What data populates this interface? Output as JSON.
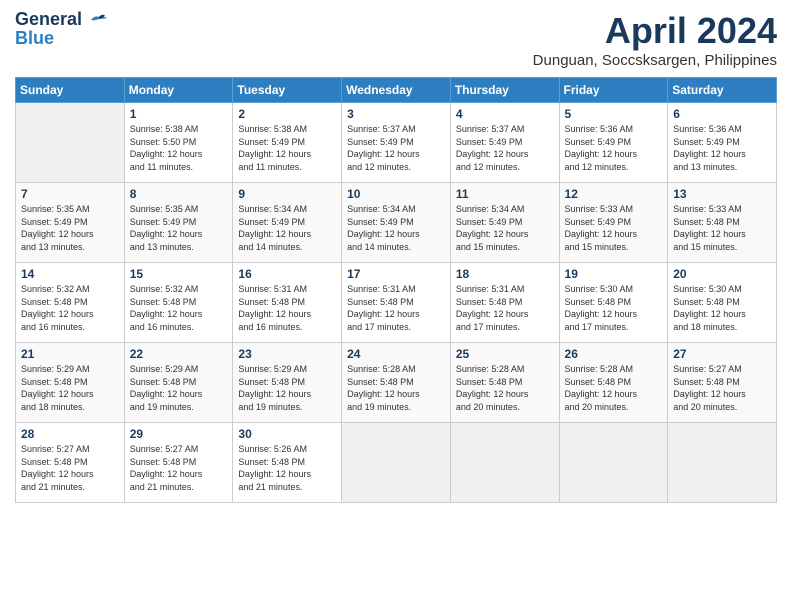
{
  "header": {
    "logo_general": "General",
    "logo_blue": "Blue",
    "month_title": "April 2024",
    "location": "Dunguan, Soccsksargen, Philippines"
  },
  "weekdays": [
    "Sunday",
    "Monday",
    "Tuesday",
    "Wednesday",
    "Thursday",
    "Friday",
    "Saturday"
  ],
  "weeks": [
    [
      {
        "day": "",
        "empty": true
      },
      {
        "day": "1",
        "sunrise": "5:38 AM",
        "sunset": "5:50 PM",
        "daylight": "12 hours and 11 minutes."
      },
      {
        "day": "2",
        "sunrise": "5:38 AM",
        "sunset": "5:49 PM",
        "daylight": "12 hours and 11 minutes."
      },
      {
        "day": "3",
        "sunrise": "5:37 AM",
        "sunset": "5:49 PM",
        "daylight": "12 hours and 12 minutes."
      },
      {
        "day": "4",
        "sunrise": "5:37 AM",
        "sunset": "5:49 PM",
        "daylight": "12 hours and 12 minutes."
      },
      {
        "day": "5",
        "sunrise": "5:36 AM",
        "sunset": "5:49 PM",
        "daylight": "12 hours and 12 minutes."
      },
      {
        "day": "6",
        "sunrise": "5:36 AM",
        "sunset": "5:49 PM",
        "daylight": "12 hours and 13 minutes."
      }
    ],
    [
      {
        "day": "7",
        "sunrise": "5:35 AM",
        "sunset": "5:49 PM",
        "daylight": "12 hours and 13 minutes."
      },
      {
        "day": "8",
        "sunrise": "5:35 AM",
        "sunset": "5:49 PM",
        "daylight": "12 hours and 13 minutes."
      },
      {
        "day": "9",
        "sunrise": "5:34 AM",
        "sunset": "5:49 PM",
        "daylight": "12 hours and 14 minutes."
      },
      {
        "day": "10",
        "sunrise": "5:34 AM",
        "sunset": "5:49 PM",
        "daylight": "12 hours and 14 minutes."
      },
      {
        "day": "11",
        "sunrise": "5:34 AM",
        "sunset": "5:49 PM",
        "daylight": "12 hours and 15 minutes."
      },
      {
        "day": "12",
        "sunrise": "5:33 AM",
        "sunset": "5:49 PM",
        "daylight": "12 hours and 15 minutes."
      },
      {
        "day": "13",
        "sunrise": "5:33 AM",
        "sunset": "5:48 PM",
        "daylight": "12 hours and 15 minutes."
      }
    ],
    [
      {
        "day": "14",
        "sunrise": "5:32 AM",
        "sunset": "5:48 PM",
        "daylight": "12 hours and 16 minutes."
      },
      {
        "day": "15",
        "sunrise": "5:32 AM",
        "sunset": "5:48 PM",
        "daylight": "12 hours and 16 minutes."
      },
      {
        "day": "16",
        "sunrise": "5:31 AM",
        "sunset": "5:48 PM",
        "daylight": "12 hours and 16 minutes."
      },
      {
        "day": "17",
        "sunrise": "5:31 AM",
        "sunset": "5:48 PM",
        "daylight": "12 hours and 17 minutes."
      },
      {
        "day": "18",
        "sunrise": "5:31 AM",
        "sunset": "5:48 PM",
        "daylight": "12 hours and 17 minutes."
      },
      {
        "day": "19",
        "sunrise": "5:30 AM",
        "sunset": "5:48 PM",
        "daylight": "12 hours and 17 minutes."
      },
      {
        "day": "20",
        "sunrise": "5:30 AM",
        "sunset": "5:48 PM",
        "daylight": "12 hours and 18 minutes."
      }
    ],
    [
      {
        "day": "21",
        "sunrise": "5:29 AM",
        "sunset": "5:48 PM",
        "daylight": "12 hours and 18 minutes."
      },
      {
        "day": "22",
        "sunrise": "5:29 AM",
        "sunset": "5:48 PM",
        "daylight": "12 hours and 19 minutes."
      },
      {
        "day": "23",
        "sunrise": "5:29 AM",
        "sunset": "5:48 PM",
        "daylight": "12 hours and 19 minutes."
      },
      {
        "day": "24",
        "sunrise": "5:28 AM",
        "sunset": "5:48 PM",
        "daylight": "12 hours and 19 minutes."
      },
      {
        "day": "25",
        "sunrise": "5:28 AM",
        "sunset": "5:48 PM",
        "daylight": "12 hours and 20 minutes."
      },
      {
        "day": "26",
        "sunrise": "5:28 AM",
        "sunset": "5:48 PM",
        "daylight": "12 hours and 20 minutes."
      },
      {
        "day": "27",
        "sunrise": "5:27 AM",
        "sunset": "5:48 PM",
        "daylight": "12 hours and 20 minutes."
      }
    ],
    [
      {
        "day": "28",
        "sunrise": "5:27 AM",
        "sunset": "5:48 PM",
        "daylight": "12 hours and 21 minutes."
      },
      {
        "day": "29",
        "sunrise": "5:27 AM",
        "sunset": "5:48 PM",
        "daylight": "12 hours and 21 minutes."
      },
      {
        "day": "30",
        "sunrise": "5:26 AM",
        "sunset": "5:48 PM",
        "daylight": "12 hours and 21 minutes."
      },
      {
        "day": "",
        "empty": true
      },
      {
        "day": "",
        "empty": true
      },
      {
        "day": "",
        "empty": true
      },
      {
        "day": "",
        "empty": true
      }
    ]
  ],
  "labels": {
    "sunrise": "Sunrise:",
    "sunset": "Sunset:",
    "daylight": "Daylight:"
  }
}
